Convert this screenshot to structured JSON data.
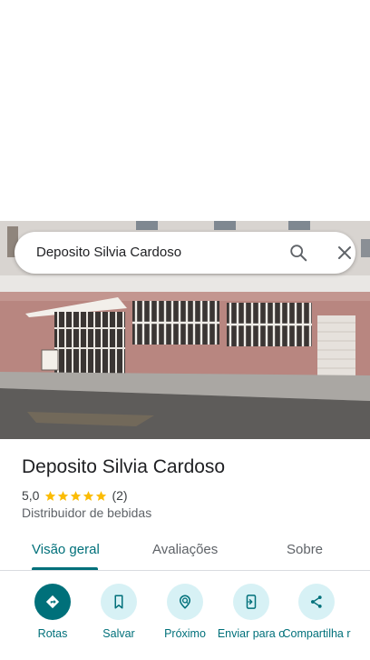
{
  "search": {
    "query": "Deposito Silvia Cardoso"
  },
  "place": {
    "name": "Deposito Silvia Cardoso",
    "rating": "5,0",
    "stars": 5,
    "review_count": "(2)",
    "category": "Distribuidor de bebidas"
  },
  "tabs": [
    {
      "label": "Visão geral",
      "active": true
    },
    {
      "label": "Avaliações",
      "active": false
    },
    {
      "label": "Sobre",
      "active": false
    }
  ],
  "actions": [
    {
      "label": "Rotas",
      "icon": "directions-icon"
    },
    {
      "label": "Salvar",
      "icon": "bookmark-icon"
    },
    {
      "label": "Próximo",
      "icon": "nearby-icon"
    },
    {
      "label": "Enviar para o",
      "icon": "send-to-phone-icon"
    },
    {
      "label": "Compartilha r",
      "icon": "share-icon"
    }
  ],
  "colors": {
    "accent": "#00707a",
    "action_bg": "#d7f1f5",
    "star": "#fbbc04"
  }
}
